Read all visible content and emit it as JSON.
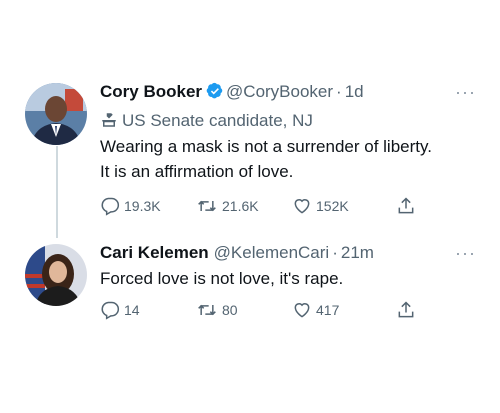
{
  "tweets": [
    {
      "name": "Cory Booker",
      "handle": "@CoryBooker",
      "separator": "·",
      "time": "1d",
      "verified": true,
      "label": "US Senate candidate, NJ",
      "text": "Wearing a mask is not a surrender of liberty. It is an affirmation of love.",
      "replies": "19.3K",
      "retweets": "21.6K",
      "likes": "152K"
    },
    {
      "name": "Cari Kelemen",
      "handle": "@KelemenCari",
      "separator": "·",
      "time": "21m",
      "verified": false,
      "text": "Forced love is not love, it's rape.",
      "replies": "14",
      "retweets": "80",
      "likes": "417"
    }
  ],
  "more_glyph": "···",
  "colors": {
    "verified": "#1d9bf0",
    "secondary_text": "#536471",
    "thread_line": "#cfd9de"
  }
}
